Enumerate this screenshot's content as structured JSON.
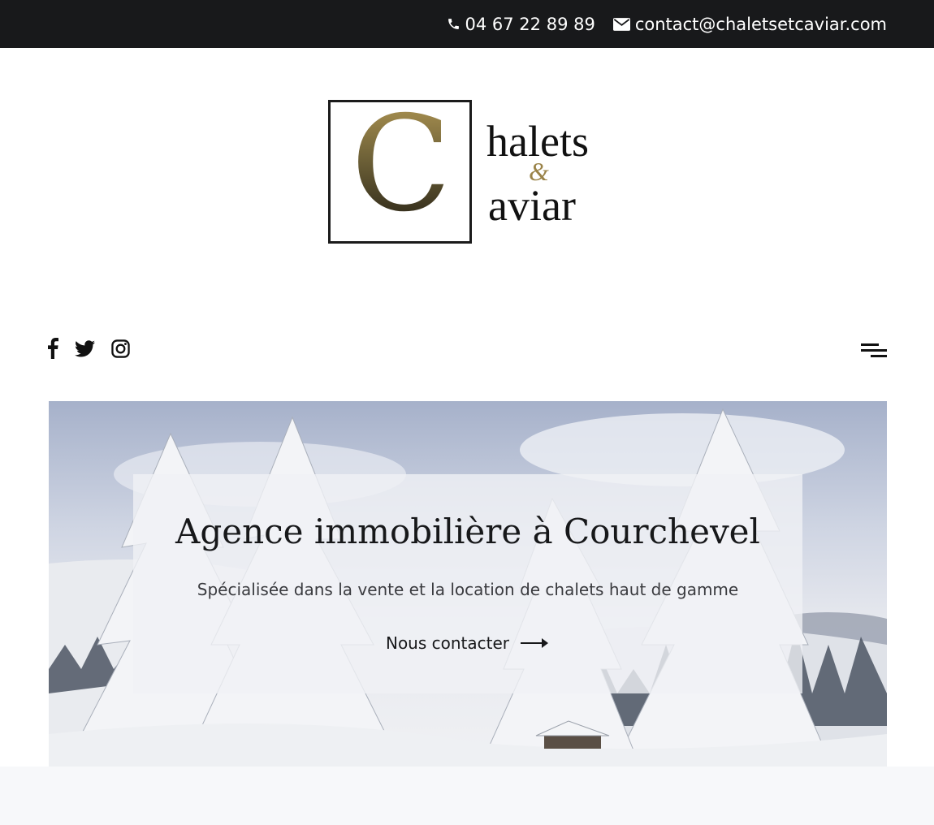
{
  "topbar": {
    "phone": "04 67 22 89 89",
    "email": "contact@chaletsetcaviar.com",
    "phone_icon": "phone-icon",
    "email_icon": "envelope-icon"
  },
  "logo": {
    "initial": "C",
    "line1": "halets",
    "amp": "&",
    "line2": "aviar"
  },
  "social": [
    "facebook-icon",
    "twitter-icon",
    "instagram-icon"
  ],
  "menu_icon": "menu-icon",
  "hero": {
    "title": "Agence immobilière à Courchevel",
    "subtitle": "Spécialisée dans la vente et la location de chalets haut de gamme",
    "cta_label": "Nous contacter",
    "cta_icon": "arrow-right-icon"
  },
  "colors": {
    "topbar_bg": "#18191b",
    "logo_gold": "#9a8348",
    "text": "#17181a"
  }
}
